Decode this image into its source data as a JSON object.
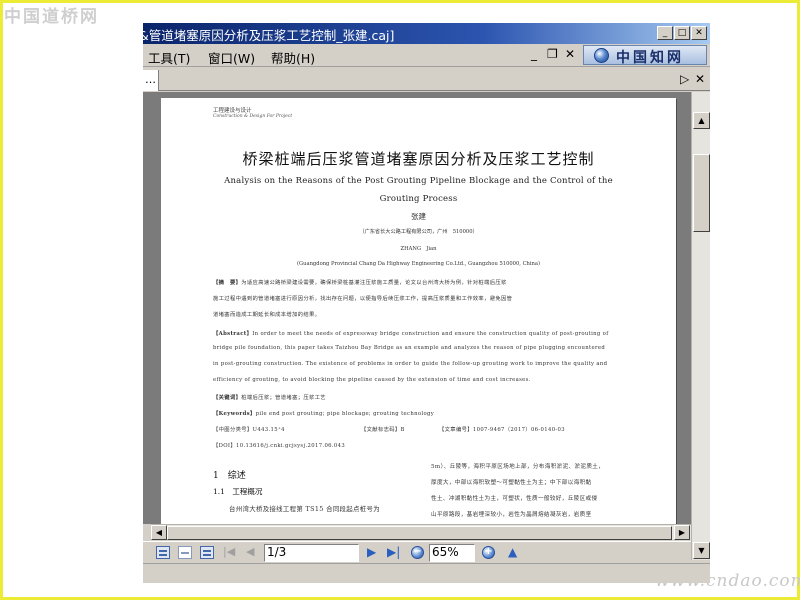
{
  "watermarks": {
    "top": "中国道桥网",
    "bottom": "www.cndao.com"
  },
  "window": {
    "title": "&管道堵塞原因分析及压浆工艺控制_张建.caj]",
    "min_glyph": "_",
    "max_glyph": "□",
    "close_glyph": "✕"
  },
  "menu": {
    "items": [
      "工具(T)",
      "窗口(W)",
      "帮助(H)"
    ],
    "logo": "中国知网",
    "mdi_min": "_",
    "mdi_restore": "❐",
    "mdi_close": "✕"
  },
  "tabs": {
    "active_label": "…",
    "next_glyph": "▷",
    "close_glyph": "✕"
  },
  "document": {
    "header_cn": "工程建设与设计",
    "header_en": "Construction & Design For Project",
    "title_cn": "桥梁桩端后压浆管道堵塞原因分析及压浆工艺控制",
    "title_en_1": "Analysis on the Reasons of the Post Grouting Pipeline Blockage and the Control of the",
    "title_en_2": "Grouting Process",
    "author_cn": "张建",
    "affil_cn": "（广东省长大公路工程有限公司，广州　510000）",
    "author_en": "ZHANG　Jian",
    "affil_en": "(Guangdong Provincial Chang  Da Highway   Engineering Co.Ltd., Guangzhou 510000, China)",
    "abstract_cn_label": "【摘　要】",
    "abstract_cn": [
      "为适应高速公路桥梁建设需要，确保桥梁桩基灌注压浆施工质量，论文以台州湾大桥为例，针对桩端后压浆",
      "施工过程中遇到的管道堵塞进行原因分析，找出存在问题，以便指导后续压浆工作，提高压浆质量和工作效率，避免因管",
      "道堵塞而造成工期延长和成本增加的结果。"
    ],
    "abstract_en_label": "【Abstract】",
    "abstract_en": [
      "In order to meet the needs of expressway bridge construction and ensure the construction quality of post-grouting of",
      "bridge pile foundation, this paper takes Taizhou Bay Bridge as an example and analyzes the reason of pipe plugging encountered",
      "in post-grouting construction. The existence of problems in order to guide the follow-up grouting work to improve the quality and",
      "efficiency of grouting, to avoid blocking the pipeline caused by the extension of time and cost increases."
    ],
    "keywords_cn_label": "【关键词】",
    "keywords_cn": "桩端后压浆；管道堵塞；压浆工艺",
    "keywords_en_label": "【Keywords】",
    "keywords_en": "pile end post grouting; pipe blockage; grouting technology",
    "class_no": "【中图分类号】U443.15⁺4",
    "doc_code": "【文献标志码】B",
    "article_no": "【文章编号】1007-9467（2017）06-0140-03",
    "doi": "【DOI】10.13616/j.cnki.gcjsysj.2017.06.043",
    "section1": "1　综述",
    "section1_1": "1.1　工程概况",
    "left_col_line": "台州湾大桥及接线工程第 TS15 合同段起点桩号为",
    "right_col": [
      "5m）、丘陵等，海积平原区场地上部，分布海积淤泥、淤泥质土，",
      "厚度大，中部以海积软塑～可塑黏性土为主；中下部以海积黏",
      "性土、冲湖积黏性土为主，可塑状，性质一般较好，丘陵区或侵",
      "山平原路段，基岩埋深较小，岩性为晶屑熔结凝灰岩，岩质坚"
    ]
  },
  "scrollbar": {
    "up": "▲",
    "down": "▼",
    "left": "◀",
    "right": "▶"
  },
  "navbar": {
    "page": "1/3",
    "zoom": "65%",
    "first_glyph": "|◀",
    "prev_glyph": "◀",
    "next_glyph": "▶",
    "last_glyph": "▶|",
    "zoom_out": "−",
    "zoom_in": "+",
    "up_glyph": "▲"
  },
  "colors": {
    "frame": "#ecec36",
    "titlebar": "#0a246a",
    "viewport": "#7b7b7b",
    "accent": "#2a5fc0"
  }
}
